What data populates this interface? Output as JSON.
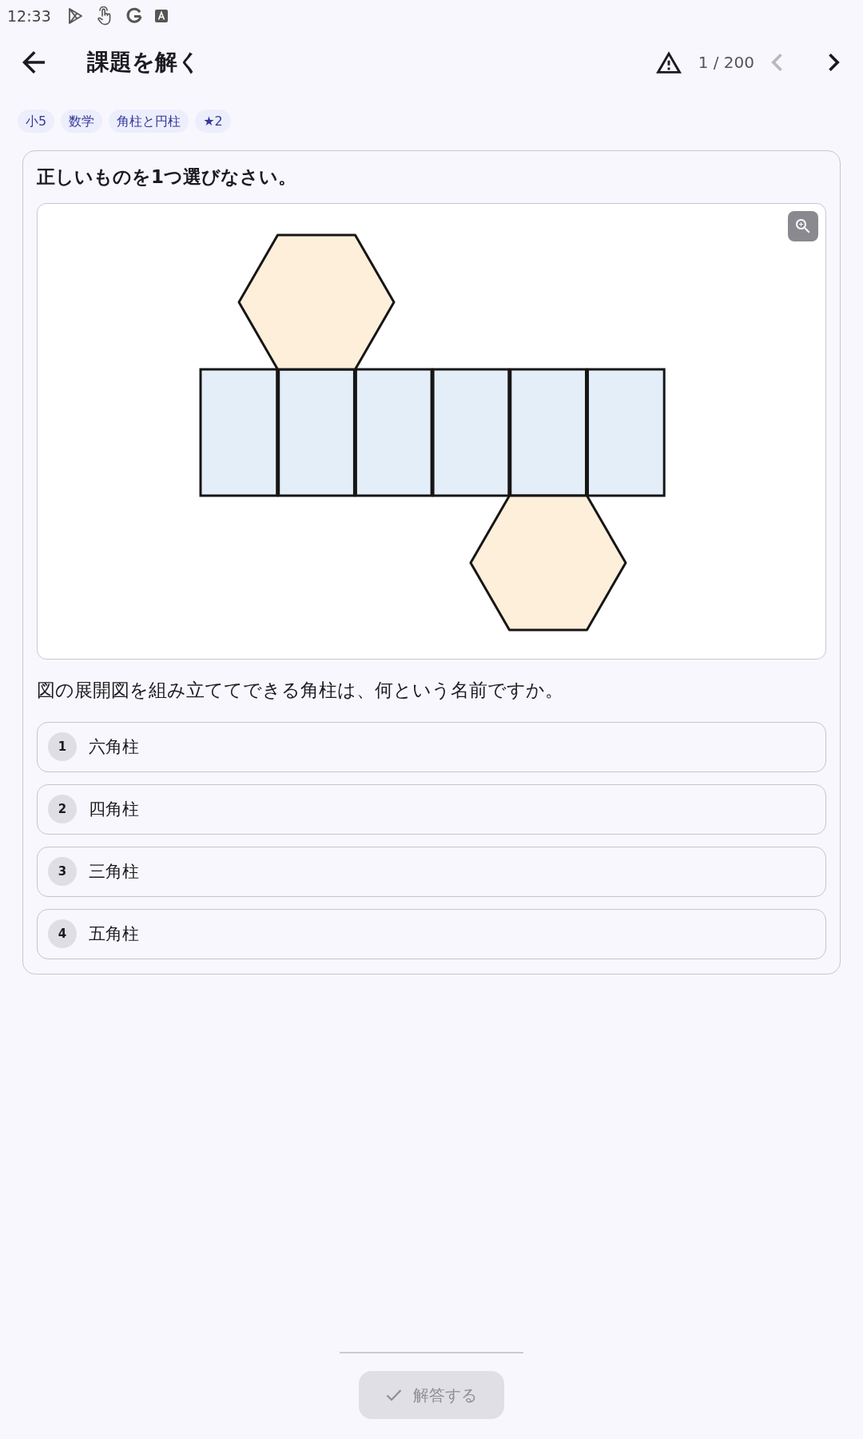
{
  "status_bar": {
    "time": "12:33"
  },
  "app_bar": {
    "title": "課題を解く",
    "counter": "1 / 200",
    "prev": {
      "disabled": true
    },
    "next": {
      "disabled": false
    }
  },
  "tags": [
    "小5",
    "数学",
    "角柱と円柱",
    "★2"
  ],
  "question": {
    "prompt": "正しいものを1つ選びなさい。",
    "text": "図の展開図を組み立ててできる角柱は、何という名前ですか。",
    "choices": [
      {
        "number": "1",
        "label": "六角柱",
        "selected": false
      },
      {
        "number": "2",
        "label": "四角柱",
        "selected": false
      },
      {
        "number": "3",
        "label": "三角柱",
        "selected": false
      },
      {
        "number": "4",
        "label": "五角柱",
        "selected": false
      }
    ]
  },
  "submit": {
    "label": "解答する",
    "disabled": true
  }
}
